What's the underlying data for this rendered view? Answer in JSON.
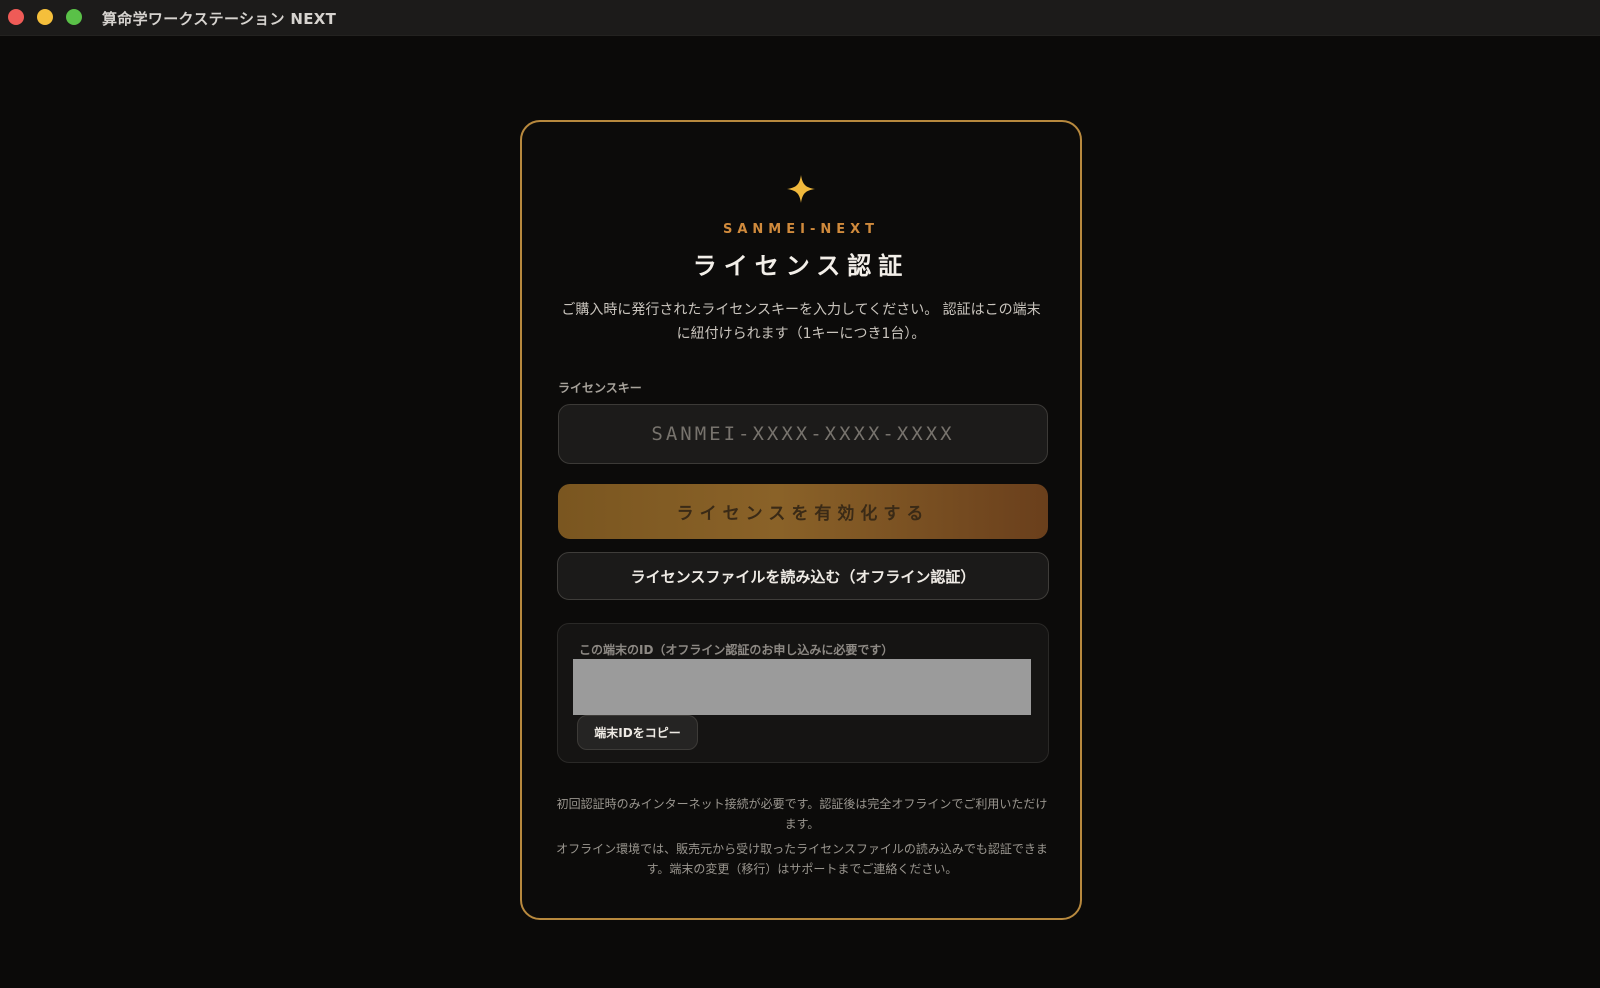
{
  "window": {
    "title": "算命学ワークステーション NEXT"
  },
  "card": {
    "icon": "sparkle-icon",
    "brand": "SANMEI-NEXT",
    "heading": "ライセンス認証",
    "description": "ご購入時に発行されたライセンスキーを入力してください。 認証はこの端末に紐付けられます（1キーにつき1台）。",
    "license_key_label": "ライセンスキー",
    "license_key_placeholder": "SANMEI-XXXX-XXXX-XXXX",
    "license_key_value": "",
    "activate_label": "ライセンスを有効化する",
    "load_file_label": "ライセンスファイルを読み込む（オフライン認証）",
    "device_id_label": "この端末のID（オフライン認証のお申し込みに必要です）",
    "device_id_value": "",
    "copy_label": "端末IDをコピー",
    "note1": "初回認証時のみインターネット接続が必要です。認証後は完全オフラインでご利用いただけます。",
    "note2": "オフライン環境では、販売元から受け取ったライセンスファイルの読み込みでも認証できます。端末の変更（移行）はサポートまでご連絡ください。"
  },
  "colors": {
    "accent_gold": "#d08a3c",
    "card_border": "#b8893e",
    "background": "#0b0a09",
    "star": "#f0b83c"
  }
}
